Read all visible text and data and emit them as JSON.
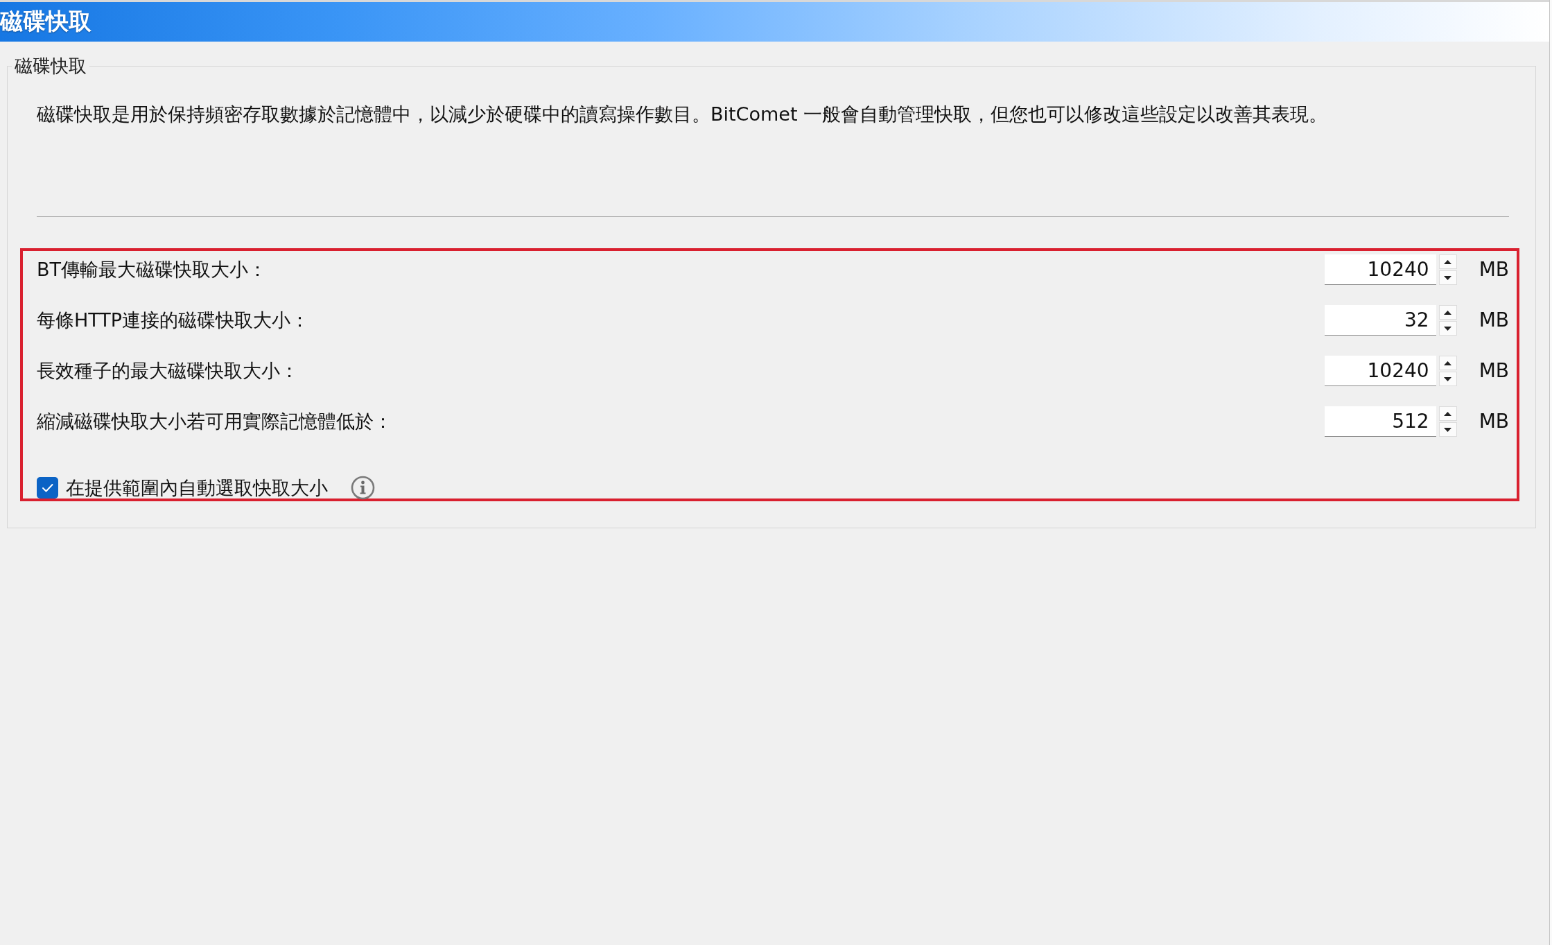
{
  "title_bar": {
    "title": "磁碟快取"
  },
  "group": {
    "legend": "磁碟快取",
    "description": "磁碟快取是用於保持頻密存取數據於記憶體中，以減少於硬碟中的讀寫操作數目。BitComet 一般會自動管理快取，但您也可以修改這些設定以改善其表現。",
    "settings": {
      "highlighted": true,
      "rows": [
        {
          "label": "BT傳輸最大磁碟快取大小：",
          "value": "10240",
          "unit": "MB"
        },
        {
          "label": "每條HTTP連接的磁碟快取大小：",
          "value": "32",
          "unit": "MB"
        },
        {
          "label": "長效種子的最大磁碟快取大小：",
          "value": "10240",
          "unit": "MB"
        },
        {
          "label": "縮減磁碟快取大小若可用實際記憶體低於：",
          "value": "512",
          "unit": "MB"
        }
      ],
      "auto_size": {
        "label": "在提供範圍內自動選取快取大小",
        "checked": true
      }
    }
  }
}
